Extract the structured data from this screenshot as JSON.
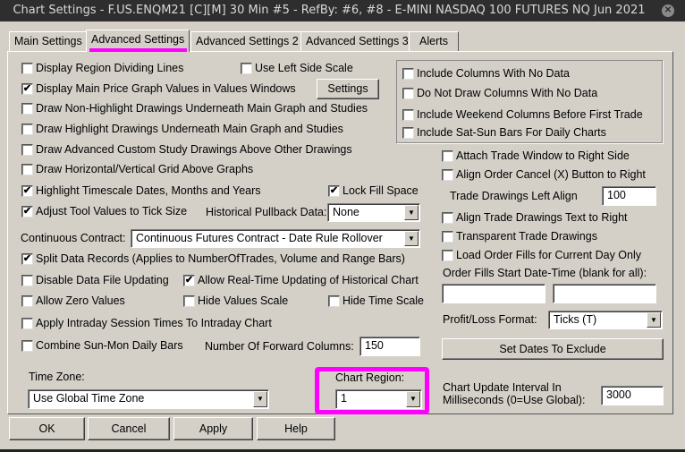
{
  "window": {
    "title": "Chart Settings - F.US.ENQM21 [C][M]  30 Min   #5 - RefBy: #6, #8 - E-MINI NASDAQ 100 FUTURES NQ Jun 2021",
    "close": "✕"
  },
  "tabs": [
    "Main Settings",
    "Advanced Settings",
    "Advanced Settings 2",
    "Advanced Settings 3",
    "Alerts"
  ],
  "checks": {
    "region_lines": {
      "label": "Display Region Dividing Lines",
      "checked": false
    },
    "left_scale": {
      "label": "Use Left Side Scale",
      "checked": false
    },
    "main_price_values": {
      "label": "Display Main Price Graph Values in Values Windows",
      "checked": true
    },
    "non_highlight_under": {
      "label": "Draw Non-Highlight Drawings Underneath Main Graph and Studies",
      "checked": false
    },
    "highlight_under": {
      "label": "Draw Highlight Drawings Underneath Main Graph and Studies",
      "checked": false
    },
    "acs_above": {
      "label": "Draw Advanced Custom Study Drawings Above Other Drawings",
      "checked": false
    },
    "grid_above": {
      "label": "Draw Horizontal/Vertical Grid Above Graphs",
      "checked": false
    },
    "highlight_timescale": {
      "label": "Highlight Timescale Dates, Months and Years",
      "checked": true
    },
    "lock_fill": {
      "label": "Lock Fill Space",
      "checked": true
    },
    "adjust_tool": {
      "label": "Adjust Tool Values to Tick Size",
      "checked": true
    },
    "split_data": {
      "label": "Split Data Records (Applies to NumberOfTrades, Volume and Range Bars)",
      "checked": true
    },
    "disable_file_updating": {
      "label": "Disable Data File Updating",
      "checked": false
    },
    "realtime_historical": {
      "label": "Allow Real-Time Updating of Historical Chart",
      "checked": true
    },
    "zero_values": {
      "label": "Allow Zero Values",
      "checked": false
    },
    "hide_values_scale": {
      "label": "Hide Values Scale",
      "checked": false
    },
    "hide_time_scale": {
      "label": "Hide Time Scale",
      "checked": false
    },
    "intraday_session": {
      "label": "Apply Intraday Session Times To Intraday Chart",
      "checked": false
    },
    "combine_sun_mon": {
      "label": "Combine Sun-Mon Daily Bars",
      "checked": false
    },
    "include_no_data": {
      "label": "Include Columns With No Data",
      "checked": false
    },
    "no_draw_no_data": {
      "label": "Do Not Draw Columns With No Data",
      "checked": false
    },
    "weekend_columns": {
      "label": "Include Weekend Columns Before First Trade",
      "checked": false
    },
    "sat_sun_bars": {
      "label": "Include Sat-Sun Bars For Daily Charts",
      "checked": false
    },
    "attach_trade_window": {
      "label": "Attach Trade Window to Right Side",
      "checked": false
    },
    "align_cancel": {
      "label": "Align Order Cancel (X) Button to Right",
      "checked": false
    },
    "align_trade_text": {
      "label": "Align Trade Drawings Text to Right",
      "checked": false
    },
    "transparent_trade": {
      "label": "Transparent Trade Drawings",
      "checked": false
    },
    "load_order_fills": {
      "label": "Load Order Fills for Current Day Only",
      "checked": false
    }
  },
  "settings_button": "Settings",
  "pullback": {
    "label": "Historical Pullback Data:",
    "value": "None"
  },
  "continuous": {
    "label": "Continuous Contract:",
    "value": "Continuous Futures Contract - Date Rule Rollover"
  },
  "forward_columns": {
    "label": "Number Of Forward Columns:",
    "value": "150"
  },
  "trade_left_align": {
    "label": "Trade Drawings Left Align",
    "value": "100"
  },
  "order_fills_start": {
    "label": "Order Fills Start Date-Time (blank for all):",
    "value1": "",
    "value2": ""
  },
  "profit_loss": {
    "label": "Profit/Loss Format:",
    "value": "Ticks (T)"
  },
  "set_dates_button": "Set Dates To Exclude",
  "time_zone": {
    "label": "Time Zone:",
    "value": "Use Global Time Zone"
  },
  "chart_region": {
    "label": "Chart Region:",
    "value": "1"
  },
  "update_interval": {
    "label1": "Chart Update Interval In",
    "label2": "Milliseconds (0=Use Global):",
    "value": "3000"
  },
  "buttons": {
    "ok": "OK",
    "cancel": "Cancel",
    "apply": "Apply",
    "help": "Help"
  },
  "dropdown_arrow": "▼"
}
